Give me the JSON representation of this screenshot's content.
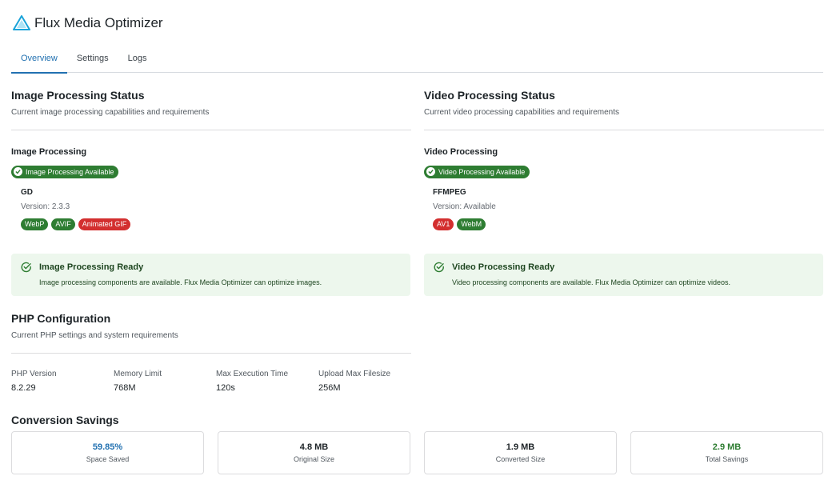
{
  "app": {
    "title": "Flux Media Optimizer"
  },
  "tabs": [
    {
      "label": "Overview",
      "active": true
    },
    {
      "label": "Settings",
      "active": false
    },
    {
      "label": "Logs",
      "active": false
    }
  ],
  "image": {
    "title": "Image Processing Status",
    "description": "Current image processing capabilities and requirements",
    "subtitle": "Image Processing",
    "status": "Image Processing Available",
    "library": "GD",
    "version": "Version: 2.3.3",
    "formats": [
      {
        "label": "WebP",
        "supported": true
      },
      {
        "label": "AVIF",
        "supported": true
      },
      {
        "label": "Animated GIF",
        "supported": false
      }
    ],
    "ready_title": "Image Processing Ready",
    "ready_desc": "Image processing components are available. Flux Media Optimizer can optimize images."
  },
  "video": {
    "title": "Video Processing Status",
    "description": "Current video processing capabilities and requirements",
    "subtitle": "Video Processing",
    "status": "Video Processing Available",
    "library": "FFMPEG",
    "version": "Version: Available",
    "formats": [
      {
        "label": "AV1",
        "supported": false
      },
      {
        "label": "WebM",
        "supported": true
      }
    ],
    "ready_title": "Video Processing Ready",
    "ready_desc": "Video processing components are available. Flux Media Optimizer can optimize videos."
  },
  "php": {
    "title": "PHP Configuration",
    "description": "Current PHP settings and system requirements",
    "items": [
      {
        "label": "PHP Version",
        "value": "8.2.29"
      },
      {
        "label": "Memory Limit",
        "value": "768M"
      },
      {
        "label": "Max Execution Time",
        "value": "120s"
      },
      {
        "label": "Upload Max Filesize",
        "value": "256M"
      }
    ]
  },
  "savings": {
    "title": "Conversion Savings",
    "cards": [
      {
        "value": "59.85%",
        "label": "Space Saved",
        "color": "#2271b1"
      },
      {
        "value": "4.8 MB",
        "label": "Original Size",
        "color": "#1d2327"
      },
      {
        "value": "1.9 MB",
        "label": "Converted Size",
        "color": "#1d2327"
      },
      {
        "value": "2.9 MB",
        "label": "Total Savings",
        "color": "#2e7d32"
      }
    ]
  },
  "colors": {
    "accent": "#2271b1",
    "success": "#2e7d32",
    "error": "#d32f2f",
    "ready_bg": "#edf7ed"
  }
}
